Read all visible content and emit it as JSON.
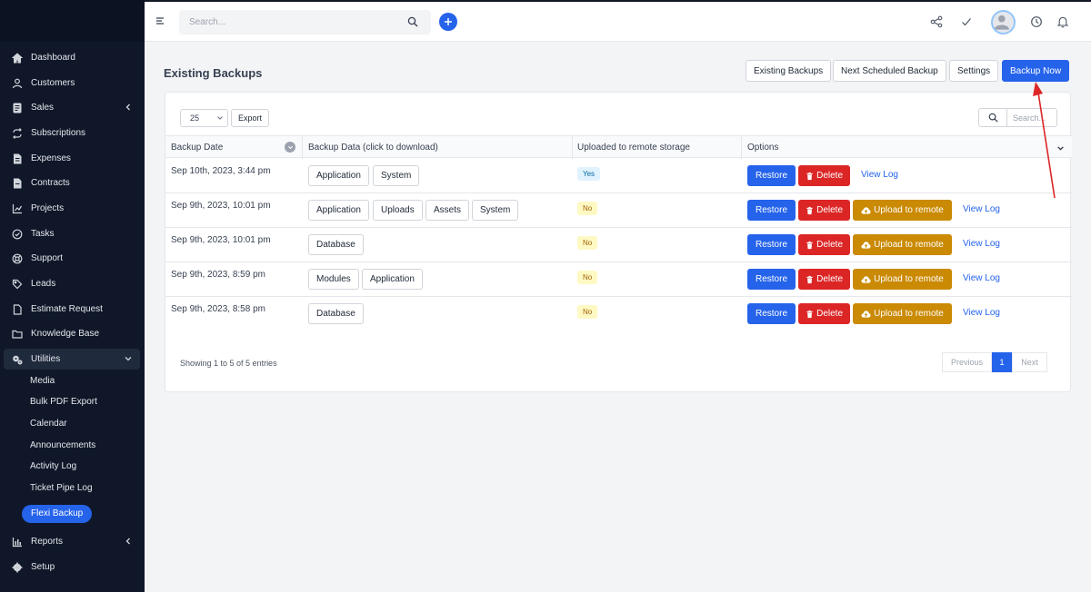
{
  "sidebar": {
    "items": [
      {
        "label": "Dashboard",
        "icon": "home-icon"
      },
      {
        "label": "Customers",
        "icon": "user-icon"
      },
      {
        "label": "Sales",
        "icon": "receipt-icon"
      },
      {
        "label": "Subscriptions",
        "icon": "repeat-icon"
      },
      {
        "label": "Expenses",
        "icon": "file-icon"
      },
      {
        "label": "Contracts",
        "icon": "document-icon"
      },
      {
        "label": "Projects",
        "icon": "chart-icon"
      },
      {
        "label": "Tasks",
        "icon": "check-circle-icon"
      },
      {
        "label": "Support",
        "icon": "lifebuoy-icon"
      },
      {
        "label": "Leads",
        "icon": "tag-icon"
      },
      {
        "label": "Estimate Request",
        "icon": "file-icon"
      },
      {
        "label": "Knowledge Base",
        "icon": "folder-icon"
      },
      {
        "label": "Utilities",
        "icon": "cogs-icon"
      }
    ],
    "utilities_sub": [
      "Media",
      "Bulk PDF Export",
      "Calendar",
      "Announcements",
      "Activity Log",
      "Ticket Pipe Log",
      "Flexi Backup"
    ],
    "reports": "Reports",
    "setup": "Setup"
  },
  "topbar": {
    "search_placeholder": "Search..."
  },
  "page": {
    "title": "Existing Backups",
    "buttons": {
      "existing": "Existing Backups",
      "next": "Next Scheduled Backup",
      "settings": "Settings",
      "backup_now": "Backup Now"
    }
  },
  "table": {
    "length": "25",
    "export": "Export",
    "search_placeholder": "Search...",
    "headers": [
      "Backup Date",
      "Backup Data (click to download)",
      "Uploaded to remote storage",
      "Options"
    ],
    "rows": [
      {
        "date": "Sep 10th, 2023, 3:44 pm",
        "files": [
          "Application",
          "System"
        ],
        "status": "Yes"
      },
      {
        "date": "Sep 9th, 2023, 10:01 pm",
        "files": [
          "Application",
          "Uploads",
          "Assets",
          "System"
        ],
        "status": "No"
      },
      {
        "date": "Sep 9th, 2023, 10:01 pm",
        "files": [
          "Database"
        ],
        "status": "No"
      },
      {
        "date": "Sep 9th, 2023, 8:59 pm",
        "files": [
          "Modules",
          "Application"
        ],
        "status": "No"
      },
      {
        "date": "Sep 9th, 2023, 8:58 pm",
        "files": [
          "Database"
        ],
        "status": "No"
      }
    ],
    "options": {
      "restore": "Restore",
      "delete": "Delete",
      "upload": "Upload to remote",
      "view_log": "View Log"
    },
    "info": "Showing 1 to 5 of 5 entries",
    "pager": {
      "previous": "Previous",
      "page": "1",
      "next": "Next"
    }
  },
  "colors": {
    "primary": "#2563eb",
    "danger": "#dc2626",
    "warning": "#ca8a04",
    "sidebar": "#0f1729",
    "annotation": "#dc2626"
  }
}
